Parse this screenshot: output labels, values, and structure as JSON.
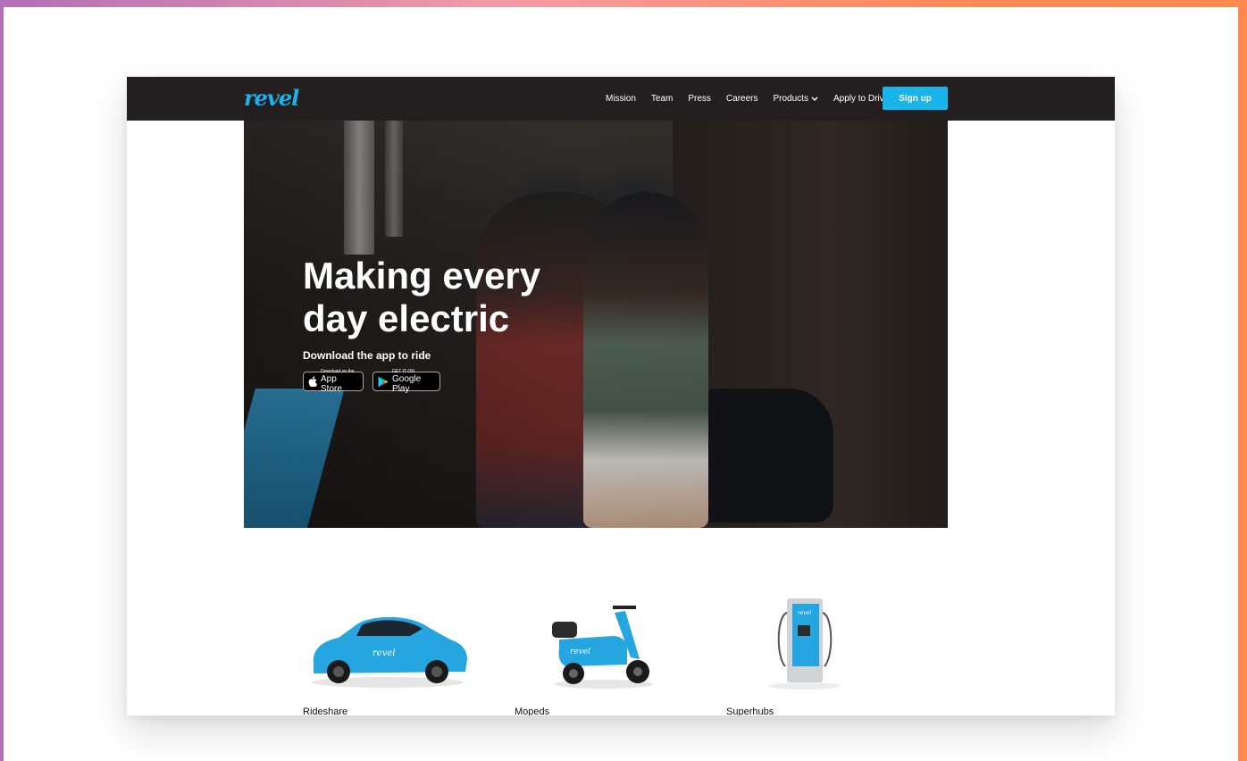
{
  "nav": {
    "logo": "revel",
    "links": [
      "Mission",
      "Team",
      "Press",
      "Careers",
      "Products",
      "Apply to Drive"
    ],
    "signup": "Sign up"
  },
  "hero": {
    "title_line1": "Making every",
    "title_line2": "day electric",
    "subtitle": "Download the app to ride",
    "app_store": {
      "small": "Download on the",
      "big": "App Store"
    },
    "google_play": {
      "small": "GET IT ON",
      "big": "Google Play"
    }
  },
  "products": [
    {
      "label": "Rideshare"
    },
    {
      "label": "Mopeds"
    },
    {
      "label": "Superhubs"
    }
  ],
  "colors": {
    "accent": "#19b4ea",
    "navbar": "#231f20"
  }
}
